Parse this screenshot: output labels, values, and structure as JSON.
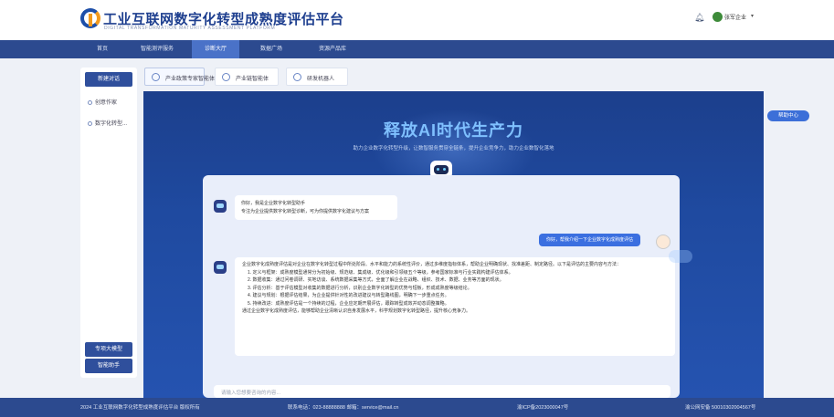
{
  "header": {
    "title": "工业互联网数字化转型成熟度评估平台",
    "subtitle": "DIGITAL TRANSFORMATION MATURITY ASSESSMENT PLATFORM",
    "username": "张军企业"
  },
  "nav": {
    "items": [
      "首页",
      "智能测评服务",
      "诊断大厅",
      "数据广场",
      "资源产品库"
    ],
    "active_index": 2
  },
  "sidebar": {
    "items": [
      "新建对话",
      "创意作家",
      "数字化转型..."
    ],
    "bottom_buttons": [
      "专项大模型",
      "智能助手"
    ]
  },
  "tool_tabs": [
    "产业政策专家智能体",
    "产业链智能体",
    "研发机器人"
  ],
  "hero": {
    "title": "释放AI时代生产力",
    "subtitle": "助力企业数字化转型升级，让数智服务贯穿全链条，提升企业竞争力，助力企业数智化落地"
  },
  "chat": {
    "bot_greeting": [
      "你好，我是企业数字化转型助手",
      "专注为企业提供数字化转型诊断，可为你提供数字化建议与方案"
    ],
    "user_question": "你好，帮我介绍一下企业数字化成熟度评估",
    "bot_answer_intro": "企业数字化成熟度评估是对企业在数字化转型过程中所处阶段、水平和能力的系统性评价，通过多维度指标体系，帮助企业明确现状、找准差距、制定路径。以下是评估的主要内容与方法：",
    "bot_answer_points": [
      "1. 定义与框架：成熟度模型通常分为初始级、规范级、集成级、优化级和引领级五个等级，参考国家标准与行业实践构建评估体系。",
      "2. 数据收集：通过问卷调研、实地访谈、系统数据采集等方式，全面了解企业在战略、组织、技术、数据、业务等方面的现状。",
      "3. 评估分析：基于评估模型对收集的数据进行分析，识别企业数字化转型的优势与短板，形成成熟度等级结论。",
      "4. 建议与规划：根据评估结果，为企业提供针对性的改进建议与转型路线图，明确下一步重点任务。",
      "5. 持续改进：成熟度评估是一个持续的过程，企业应定期开展评估，跟踪转型成效并动态调整策略。"
    ],
    "bot_answer_outro": "通过企业数字化成熟度评估，能够帮助企业清晰认识自身发展水平，科学规划数字化转型路径，提升核心竞争力。",
    "input_placeholder": "请输入您想要咨询的内容..."
  },
  "float_button": "帮助中心",
  "footer": {
    "copyright": "2024 工业互联网数字化转型成熟度评估平台 版权所有",
    "contact": "联系电话：023-88888888   邮箱：service@mail.cn",
    "icp": "渝ICP备2023000047号",
    "police": "渝公网安备 50010302004567号"
  }
}
